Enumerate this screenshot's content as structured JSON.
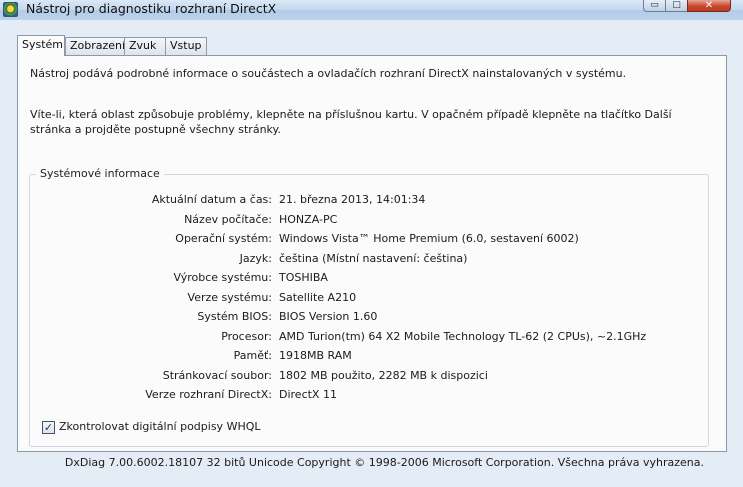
{
  "window": {
    "title": "Nástroj pro diagnostiku rozhraní DirectX",
    "icon": "directx-app-icon",
    "controls": {
      "minimize": "▭",
      "maximize": "□",
      "close": "✕"
    }
  },
  "tabs": [
    {
      "label": "Systém",
      "active": true
    },
    {
      "label": "Zobrazení",
      "active": false
    },
    {
      "label": "Zvuk",
      "active": false
    },
    {
      "label": "Vstup",
      "active": false
    }
  ],
  "system_tab": {
    "intro_line": "Nástroj podává podrobné informace o součástech a ovladačích rozhraní DirectX nainstalovaných v systému.",
    "instructions": "Víte-li, která oblast způsobuje problémy, klepněte na příslušnou kartu. V opačném případě klepněte na tlačítko Další stránka a projděte postupně všechny stránky.",
    "group_title": "Systémové informace",
    "info": [
      {
        "label": "Aktuální datum a čas:",
        "value": "21. března 2013, 14:01:34"
      },
      {
        "label": "Název počítače:",
        "value": "HONZA-PC"
      },
      {
        "label": "Operační systém:",
        "value": "Windows Vista™ Home Premium (6.0, sestavení 6002)"
      },
      {
        "label": "Jazyk:",
        "value": "čeština (Místní nastavení: čeština)"
      },
      {
        "label": "Výrobce systému:",
        "value": "TOSHIBA"
      },
      {
        "label": "Verze systému:",
        "value": "Satellite A210"
      },
      {
        "label": "Systém BIOS:",
        "value": "BIOS Version 1.60"
      },
      {
        "label": "Procesor:",
        "value": "AMD Turion(tm) 64 X2 Mobile Technology TL-62 (2 CPUs), ~2.1GHz"
      },
      {
        "label": "Paměť:",
        "value": "1918MB RAM"
      },
      {
        "label": "Stránkovací soubor:",
        "value": "1802 MB použito, 2282 MB k dispozici"
      },
      {
        "label": "Verze rozhraní DirectX:",
        "value": "DirectX 11"
      }
    ],
    "whql_checkbox": {
      "label": "Zkontrolovat digitální podpisy WHQL",
      "checked": true,
      "mark": "✓"
    }
  },
  "footer": "DxDiag 7.00.6002.18107 32 bitů Unicode Copyright © 1998-2006 Microsoft Corporation. Všechna práva vyhrazena."
}
